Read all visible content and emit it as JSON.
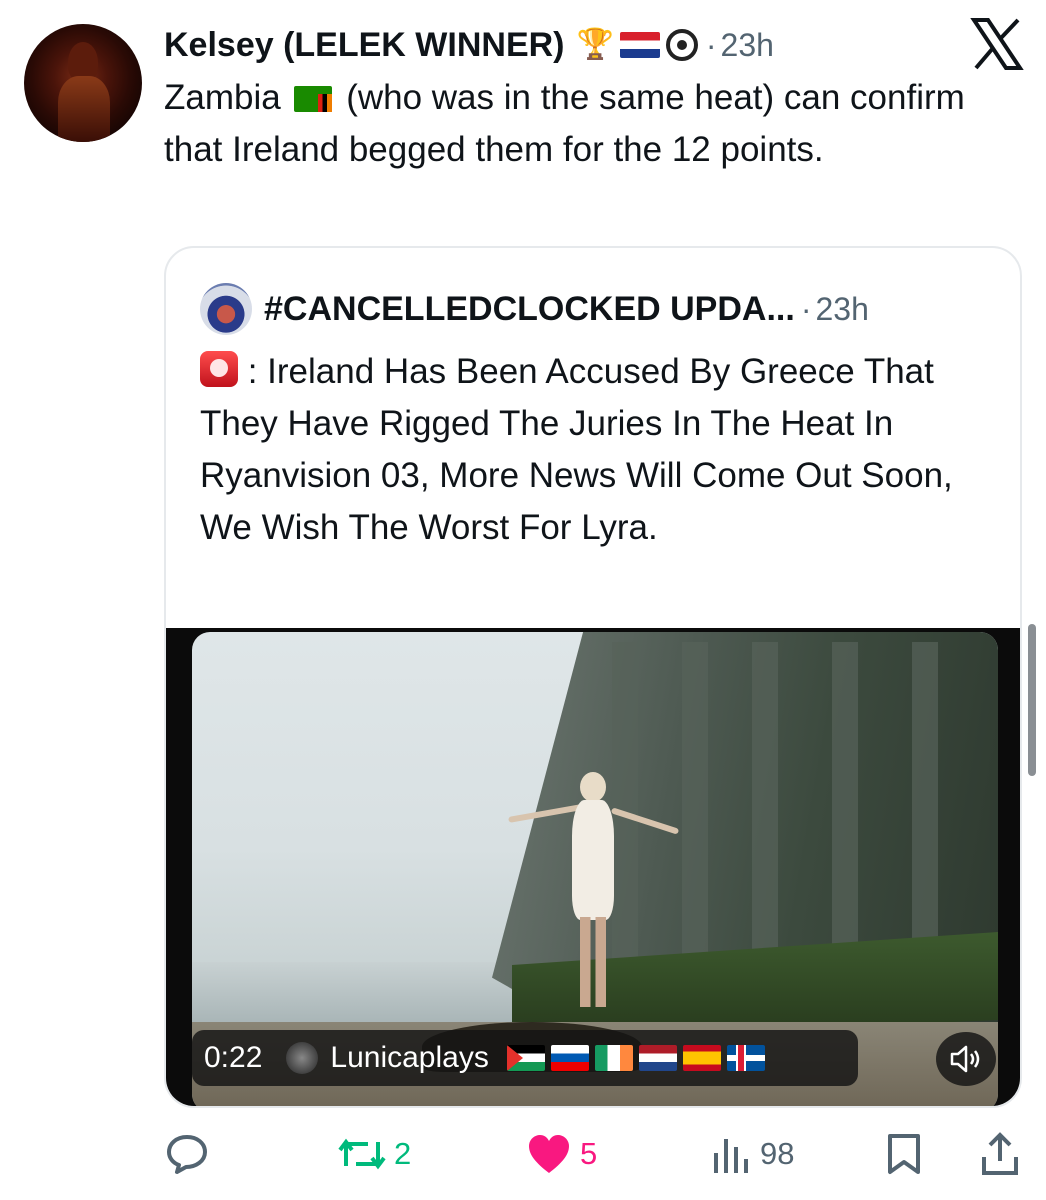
{
  "post": {
    "author": "Kelsey (LELEK WINNER)",
    "separator": "·",
    "time": "23h",
    "text_part1": "Zambia",
    "text_part2": "(who was in the same heat) can confirm that Ireland begged them for the 12 points.",
    "badges": [
      "trophy-icon",
      "croatia-flag",
      "eye-badge-icon"
    ]
  },
  "quoted": {
    "author": "#CANCELLEDCLOCKED UPDA...",
    "separator": "·",
    "time": "23h",
    "text": ": Ireland Has Been Accused By Greece That They Have Rigged The Juries In The Heat In Ryanvision 03, More News Will Come Out Soon, We Wish The Worst For Lyra.",
    "video": {
      "timestamp": "0:22",
      "channel": "Lunicaplays",
      "flags": [
        "palestine",
        "slovenia",
        "ireland",
        "netherlands",
        "spain",
        "iceland"
      ]
    }
  },
  "actions": {
    "reply_count": "",
    "repost_count": "2",
    "like_count": "5",
    "views_count": "98"
  },
  "colors": {
    "like": "#f91880",
    "repost": "#00ba7c",
    "secondary_text": "#536471",
    "primary_text": "#0f1419"
  }
}
